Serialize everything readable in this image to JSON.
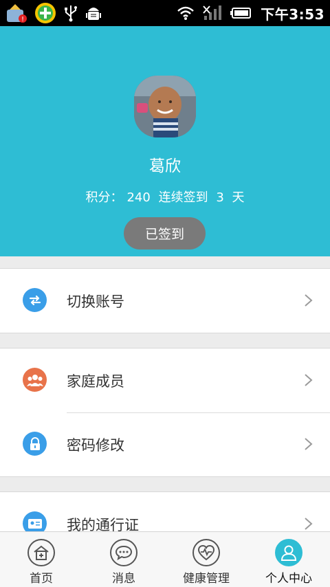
{
  "status_bar": {
    "time": "下午3:53",
    "icons": [
      "cleaner-app-icon",
      "plus-app-icon",
      "usb-icon",
      "android-debug-icon",
      "wifi-icon",
      "no-signal-icon",
      "battery-icon"
    ]
  },
  "profile": {
    "name": "葛欣",
    "points_label": "积分：",
    "points_value": "240",
    "streak_label": "连续签到",
    "streak_value": "3",
    "streak_unit": "天",
    "signin_button": "已签到"
  },
  "menu": {
    "switch_account": "切换账号",
    "family_members": "家庭成员",
    "change_password": "密码修改",
    "my_pass": "我的通行证"
  },
  "tabs": [
    {
      "label": "首页",
      "icon": "home-icon"
    },
    {
      "label": "消息",
      "icon": "message-icon"
    },
    {
      "label": "健康管理",
      "icon": "health-icon"
    },
    {
      "label": "个人中心",
      "icon": "user-icon"
    }
  ],
  "colors": {
    "header_bg": "#2ebdd4",
    "signin_bg": "#7a7a7a",
    "switch_icon": "#3a9ee8",
    "family_icon": "#e8734a",
    "password_icon": "#3a9ee8"
  }
}
